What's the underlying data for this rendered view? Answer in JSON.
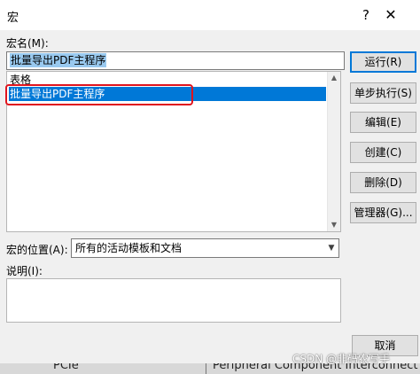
{
  "window": {
    "title": "宏",
    "help_glyph": "?",
    "close_glyph": "✕"
  },
  "macro_name": {
    "label": "宏名(M):",
    "value": "批量导出PDF主程序"
  },
  "macro_list": {
    "items": [
      {
        "label": "表格"
      },
      {
        "label": "批量导出PDF主程序",
        "selected": true
      }
    ]
  },
  "buttons": {
    "run": "运行(R)",
    "step_into": "单步执行(S)",
    "edit": "编辑(E)",
    "create": "创建(C)",
    "delete": "删除(D)",
    "organizer": "管理器(G)...",
    "cancel": "取消"
  },
  "macros_in": {
    "label": "宏的位置(A):",
    "selected": "所有的活动模板和文档"
  },
  "description": {
    "label": "说明(I):",
    "value": ""
  },
  "background": {
    "left_text": "PCIe",
    "right_text": "Peripheral Component Interconnect"
  },
  "watermark": "CSDN @非码农写手",
  "colors": {
    "selection": "#0078d7",
    "highlight_box": "#e0141e",
    "default_button_border": "#0078d7"
  }
}
